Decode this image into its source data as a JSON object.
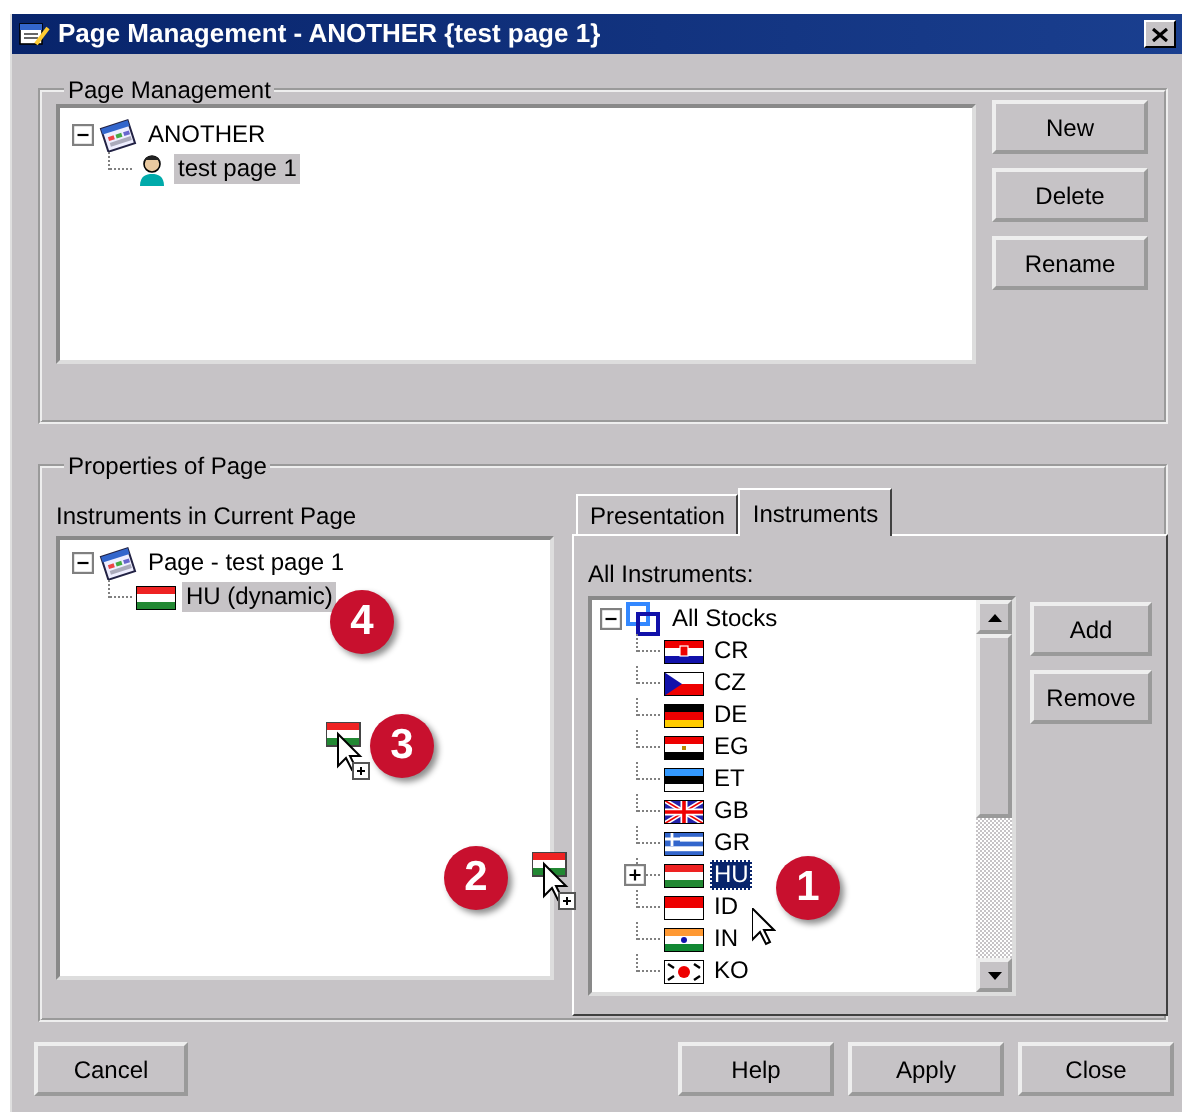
{
  "window": {
    "title": "Page Management - ANOTHER {test page 1}"
  },
  "page_management": {
    "legend": "Page Management",
    "tree": [
      {
        "label": "ANOTHER",
        "kind": "page",
        "expanded": true,
        "selected": false,
        "children": [
          {
            "label": "test page 1",
            "kind": "person",
            "selected": true
          }
        ]
      }
    ],
    "buttons": [
      "New",
      "Delete",
      "Rename"
    ]
  },
  "properties": {
    "legend": "Properties of Page",
    "current_label": "Instruments in Current Page",
    "current_tree": [
      {
        "label": "Page - test page 1",
        "kind": "page",
        "expanded": true,
        "selected": false,
        "children": [
          {
            "label": "HU (dynamic)",
            "kind": "hungary",
            "selected": true
          }
        ]
      }
    ],
    "tabs": [
      {
        "label": "Presentation",
        "selected": false
      },
      {
        "label": "Instruments",
        "selected": true
      }
    ],
    "all_label": "All Instruments:",
    "instruments": [
      {
        "label": "All Stocks",
        "kind": "stocks",
        "expanded": true,
        "selected": false,
        "children": [
          {
            "label": "CR",
            "kind": "croatia",
            "selected": false
          },
          {
            "label": "CZ",
            "kind": "czech",
            "selected": false
          },
          {
            "label": "DE",
            "kind": "germany",
            "selected": false
          },
          {
            "label": "EG",
            "kind": "egypt",
            "selected": false
          },
          {
            "label": "ET",
            "kind": "estonia",
            "selected": false
          },
          {
            "label": "GB",
            "kind": "uk",
            "selected": false
          },
          {
            "label": "GR",
            "kind": "greece",
            "selected": false
          },
          {
            "label": "HU",
            "kind": "hungary",
            "selected": true,
            "expanded": false
          },
          {
            "label": "ID",
            "kind": "indonesia",
            "selected": false
          },
          {
            "label": "IN",
            "kind": "india",
            "selected": false
          },
          {
            "label": "KO",
            "kind": "korea",
            "selected": false
          }
        ]
      }
    ],
    "side_buttons": [
      "Add",
      "Remove"
    ]
  },
  "footer": {
    "left": [
      "Cancel"
    ],
    "right": [
      "Help",
      "Apply",
      "Close"
    ]
  },
  "callouts": [
    {
      "label": "1"
    },
    {
      "label": "2"
    },
    {
      "label": "3"
    },
    {
      "label": "4"
    }
  ]
}
